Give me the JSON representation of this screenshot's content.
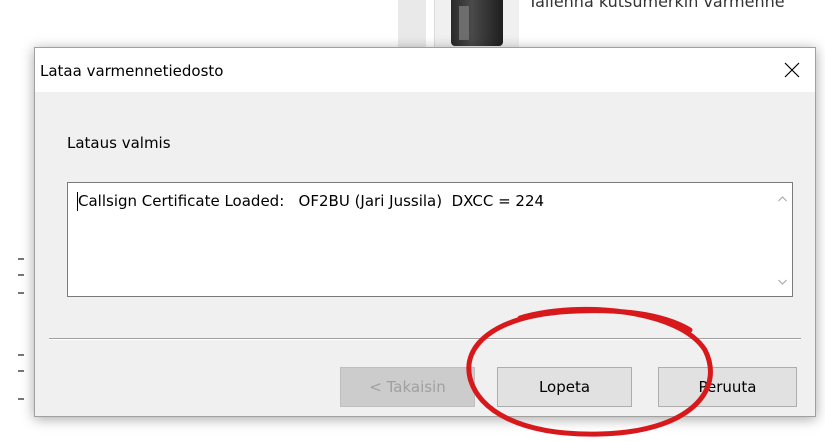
{
  "background_window": {
    "text": "Tallenna kutsumerkin varmenne"
  },
  "dialog": {
    "title": "Lataa varmennetiedosto",
    "status_label": "Lataus valmis",
    "message": "Callsign Certificate Loaded:   OF2BU (Jari Jussila)  DXCC = 224",
    "buttons": {
      "back": "< Takaisin",
      "finish": "Lopeta",
      "cancel": "Peruuta"
    }
  },
  "icons": {
    "close": "close-icon",
    "scroll_up": "scroll-up-arrow-icon",
    "scroll_down": "scroll-down-arrow-icon"
  },
  "colors": {
    "annotation": "#d7191c",
    "dialog_bg": "#f0f0f0",
    "button_bg": "#e1e1e1"
  }
}
